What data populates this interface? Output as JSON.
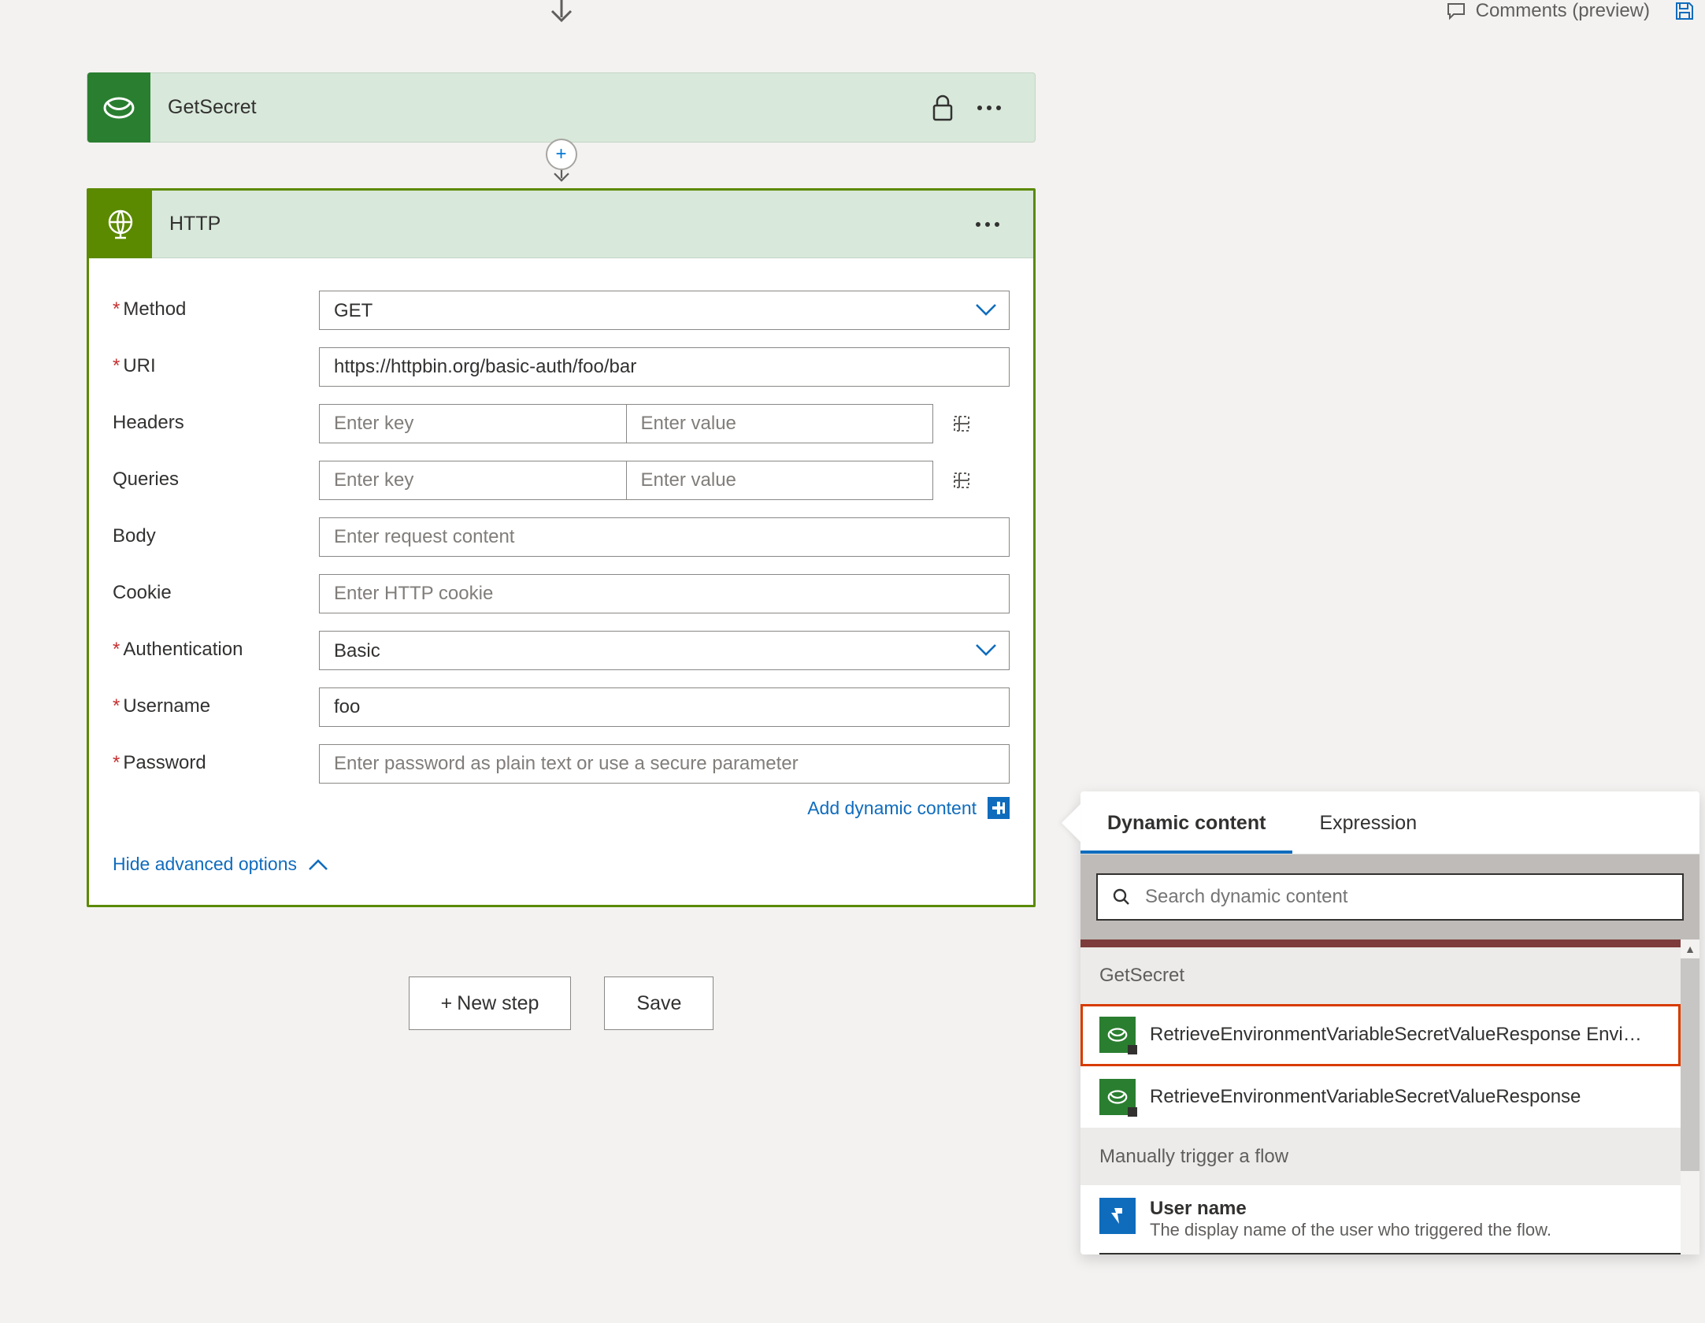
{
  "topbar": {
    "comments_label": "Comments (preview)"
  },
  "step_getsecret": {
    "title": "GetSecret"
  },
  "http": {
    "title": "HTTP",
    "fields": {
      "method": {
        "label": "Method",
        "value": "GET"
      },
      "uri": {
        "label": "URI",
        "value": "https://httpbin.org/basic-auth/foo/bar"
      },
      "headers": {
        "label": "Headers",
        "key_placeholder": "Enter key",
        "value_placeholder": "Enter value"
      },
      "queries": {
        "label": "Queries",
        "key_placeholder": "Enter key",
        "value_placeholder": "Enter value"
      },
      "body": {
        "label": "Body",
        "placeholder": "Enter request content"
      },
      "cookie": {
        "label": "Cookie",
        "placeholder": "Enter HTTP cookie"
      },
      "authentication": {
        "label": "Authentication",
        "value": "Basic"
      },
      "username": {
        "label": "Username",
        "value": "foo"
      },
      "password": {
        "label": "Password",
        "placeholder": "Enter password as plain text or use a secure parameter"
      }
    },
    "add_dynamic_content": "Add dynamic content",
    "hide_advanced": "Hide advanced options"
  },
  "bottom": {
    "new_step": "New step",
    "save": "Save"
  },
  "dynamic_panel": {
    "tabs": {
      "dynamic": "Dynamic content",
      "expression": "Expression"
    },
    "search_placeholder": "Search dynamic content",
    "groups": [
      {
        "header": "GetSecret",
        "items": [
          {
            "title": "RetrieveEnvironmentVariableSecretValueResponse Envi…",
            "highlighted": true
          },
          {
            "title": "RetrieveEnvironmentVariableSecretValueResponse",
            "highlighted": false
          }
        ]
      },
      {
        "header": "Manually trigger a flow",
        "items_flow": [
          {
            "title": "User name",
            "subtitle": "The display name of the user who triggered the flow."
          }
        ]
      }
    ]
  }
}
